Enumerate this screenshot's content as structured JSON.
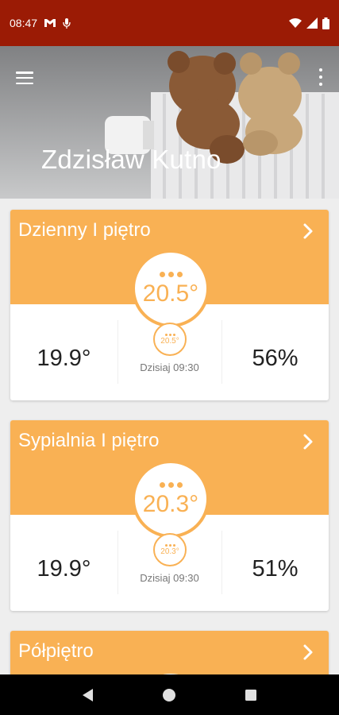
{
  "status_bar": {
    "time": "08:47",
    "notification_icons": [
      "mail-icon",
      "mic-icon"
    ],
    "system_icons": [
      "wifi-icon",
      "signal-icon",
      "battery-icon"
    ]
  },
  "header": {
    "title": "Zdzisław Kutno",
    "menu_icon": "hamburger-menu-icon",
    "overflow_icon": "overflow-menu-icon"
  },
  "rooms": [
    {
      "name": "Dzienny I piętro",
      "setpoint": "20.5°",
      "current_temp": "19.9°",
      "schedule_setpoint": "20.5°",
      "schedule_time": "Dzisiaj 09:30",
      "humidity": "56%"
    },
    {
      "name": "Sypialnia I piętro",
      "setpoint": "20.3°",
      "current_temp": "19.9°",
      "schedule_setpoint": "20.3°",
      "schedule_time": "Dzisiaj 09:30",
      "humidity": "51%"
    },
    {
      "name": "Półpiętro"
    }
  ],
  "nav_bar": {
    "buttons": [
      "back-icon",
      "home-icon",
      "recents-icon"
    ]
  },
  "colors": {
    "status_bar": "#9b1b05",
    "accent": "#f9b154",
    "background": "#eeeeee"
  }
}
